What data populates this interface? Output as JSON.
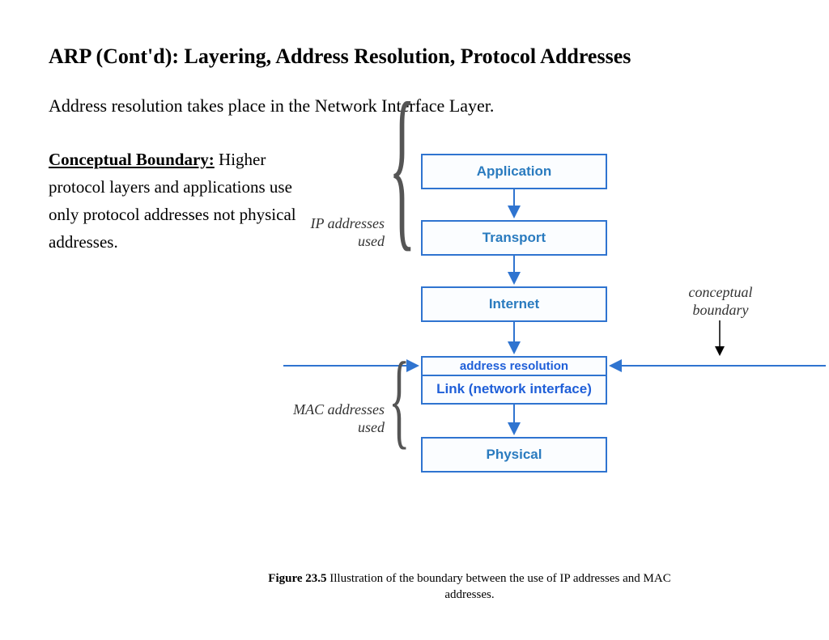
{
  "title": "ARP (Cont'd): Layering, Address Resolution, Protocol Addresses",
  "subtitle": "Address resolution takes place in the Network Interface Layer.",
  "paragraph": {
    "lead": "Conceptual Boundary:",
    "body": "  Higher protocol layers and applications use only protocol addresses not physical addresses."
  },
  "layers": {
    "application": "Application",
    "transport": "Transport",
    "internet": "Internet",
    "addr_res": "address resolution",
    "link": "Link (network interface)",
    "physical": "Physical"
  },
  "annotations": {
    "ip_used_l1": "IP addresses",
    "ip_used_l2": "used",
    "mac_used_l1": "MAC addresses",
    "mac_used_l2": "used",
    "boundary_l1": "conceptual",
    "boundary_l2": "boundary"
  },
  "caption": {
    "fig": "Figure 23.5",
    "text": " Illustration of the boundary between the use of IP addresses and MAC addresses."
  }
}
